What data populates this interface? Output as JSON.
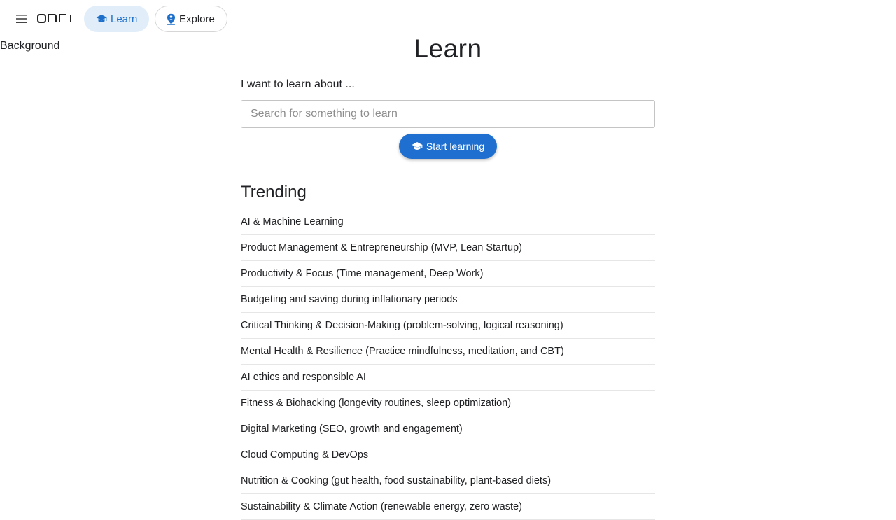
{
  "header": {
    "logo_text": "onri",
    "nav": [
      {
        "label": "Learn",
        "icon": "graduation-cap-icon",
        "active": true
      },
      {
        "label": "Explore",
        "icon": "map-pin-person-icon",
        "active": false
      }
    ]
  },
  "background": {
    "alt_text": "Background"
  },
  "main": {
    "title": "Learn",
    "prompt_label": "I want to learn about ...",
    "search_placeholder": "Search for something to learn",
    "search_value": "",
    "start_button_label": "Start learning",
    "start_button_icon": "graduation-cap-icon"
  },
  "trending": {
    "heading": "Trending",
    "items": [
      "AI & Machine Learning",
      "Product Management & Entrepreneurship (MVP, Lean Startup)",
      "Productivity & Focus (Time management, Deep Work)",
      "Budgeting and saving during inflationary periods",
      "Critical Thinking & Decision-Making (problem-solving, logical reasoning)",
      "Mental Health & Resilience (Practice mindfulness, meditation, and CBT)",
      "AI ethics and responsible AI",
      "Fitness & Biohacking (longevity routines, sleep optimization)",
      "Digital Marketing (SEO, growth and engagement)",
      "Cloud Computing & DevOps",
      "Nutrition & Cooking (gut health, food sustainability, plant-based diets)",
      "Sustainability & Climate Action (renewable energy, zero waste)"
    ]
  },
  "colors": {
    "accent": "#1e6fd0",
    "active_pill_bg": "#e1eefa",
    "divider": "#e6e6e6"
  }
}
